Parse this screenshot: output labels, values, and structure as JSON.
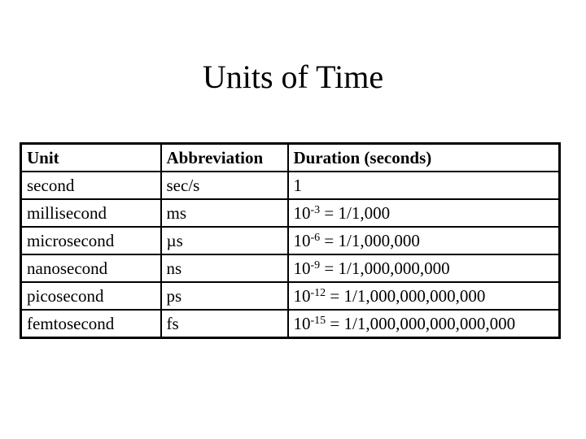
{
  "slide": {
    "title": "Units of Time"
  },
  "table": {
    "headers": [
      "Unit",
      "Abbreviation",
      "Duration (seconds)"
    ],
    "rows": [
      {
        "unit": "second",
        "abbreviation": "sec/s",
        "duration_base": "1",
        "duration_exp": "",
        "duration_rest": ""
      },
      {
        "unit": "millisecond",
        "abbreviation": "ms",
        "duration_base": "10",
        "duration_exp": "-3",
        "duration_rest": " = 1/1,000"
      },
      {
        "unit": "microsecond",
        "abbreviation": "µs",
        "duration_base": "10",
        "duration_exp": "-6",
        "duration_rest": " = 1/1,000,000"
      },
      {
        "unit": "nanosecond",
        "abbreviation": "ns",
        "duration_base": "10",
        "duration_exp": "-9",
        "duration_rest": " = 1/1,000,000,000"
      },
      {
        "unit": "picosecond",
        "abbreviation": "ps",
        "duration_base": "10",
        "duration_exp": "-12",
        "duration_rest": " = 1/1,000,000,000,000"
      },
      {
        "unit": "femtosecond",
        "abbreviation": "fs",
        "duration_base": "10",
        "duration_exp": "-15",
        "duration_rest": " = 1/1,000,000,000,000,000"
      }
    ]
  }
}
